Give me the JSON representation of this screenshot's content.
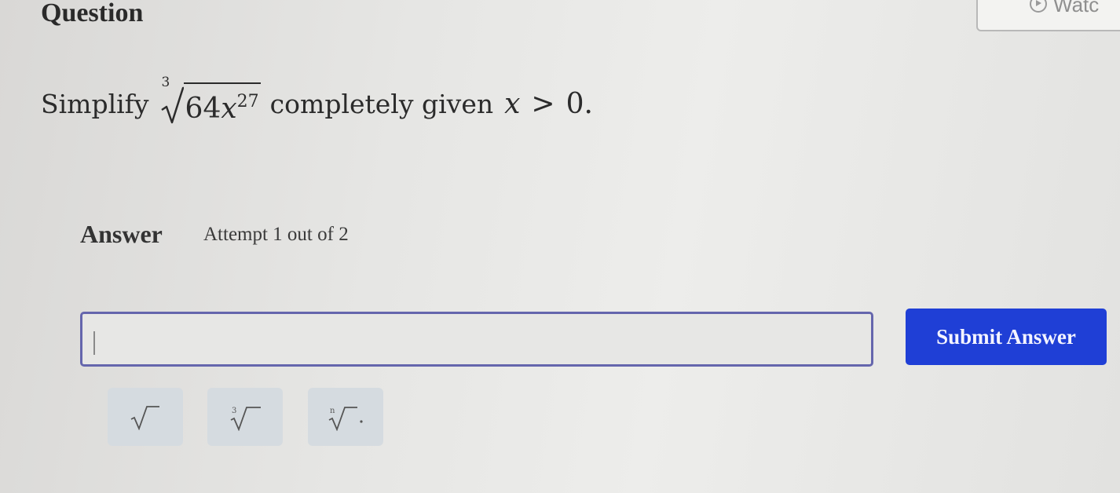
{
  "header": {
    "title": "Question",
    "watch_label": "Watc"
  },
  "question": {
    "prefix": "Simplify",
    "root_index": "3",
    "radicand_coefficient": "64",
    "radicand_variable": "x",
    "radicand_exponent": "27",
    "suffix": "completely given",
    "condition_variable": "x",
    "condition_operator": ">",
    "condition_value": "0."
  },
  "answer": {
    "label": "Answer",
    "attempt_text": "Attempt 1 out of 2",
    "input_value": "",
    "submit_label": "Submit Answer"
  },
  "toolbar": {
    "buttons": [
      {
        "icon": "square-root-icon"
      },
      {
        "icon": "cube-root-icon",
        "index": "3"
      },
      {
        "icon": "nth-root-icon",
        "index": "n"
      }
    ]
  }
}
